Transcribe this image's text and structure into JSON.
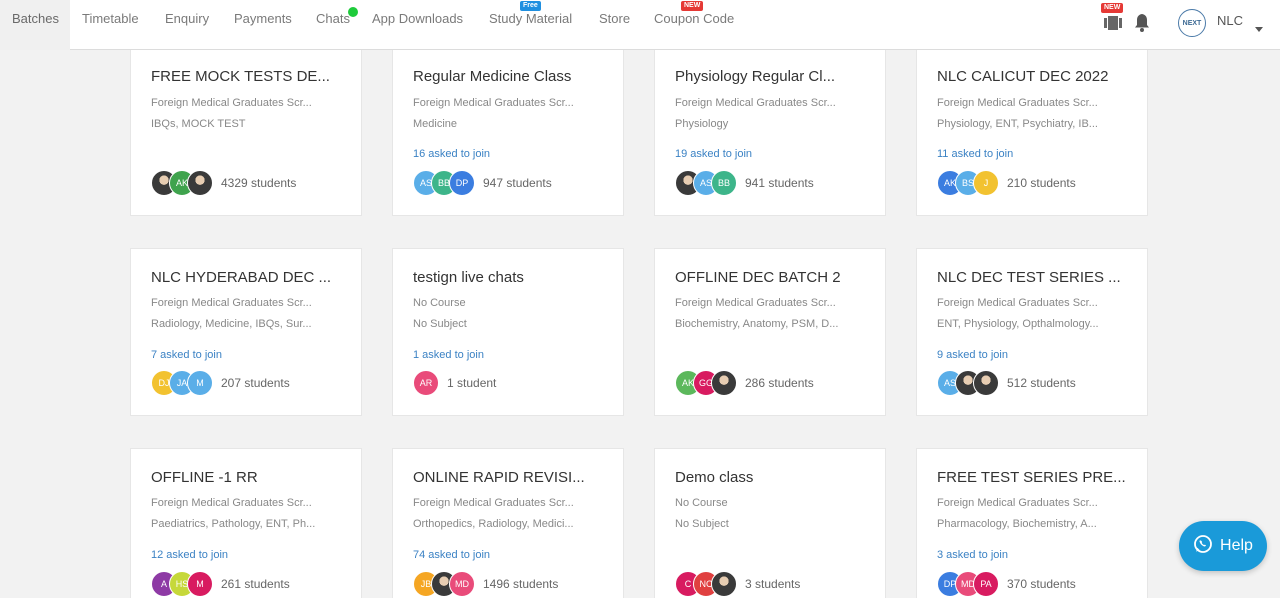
{
  "nav": {
    "items": [
      "Batches",
      "Timetable",
      "Enquiry",
      "Payments",
      "Chats",
      "App Downloads",
      "Study Material",
      "Store",
      "Coupon Code"
    ],
    "active": "Batches",
    "badges": {
      "free": "Free",
      "new": "NEW",
      "video_new": "NEW"
    },
    "online_color": "#1ecb3b"
  },
  "header_right": {
    "org_logo_text": "NEXT",
    "org_name": "NLC",
    "icons": [
      "video-library-icon",
      "bell-icon",
      "caret-down-icon"
    ]
  },
  "cards": [
    {
      "title": "FREE MOCK TESTS DE...",
      "line1": "Foreign Medical Graduates Scr...",
      "line2": "IBQs, MOCK TEST",
      "asked": "",
      "avatars": [
        {
          "t": "",
          "c": "photo"
        },
        {
          "t": "AK",
          "c": "#3fa34d"
        },
        {
          "t": "",
          "c": "photo"
        }
      ],
      "students": "4329 students"
    },
    {
      "title": "Regular Medicine Class",
      "line1": "Foreign Medical Graduates Scr...",
      "line2": "Medicine",
      "asked": "16 asked to join",
      "avatars": [
        {
          "t": "AS",
          "c": "#5aaee8"
        },
        {
          "t": "BB",
          "c": "#3db58a"
        },
        {
          "t": "DP",
          "c": "#3b7de0"
        }
      ],
      "students": "947 students"
    },
    {
      "title": "Physiology Regular Cl...",
      "line1": "Foreign Medical Graduates Scr...",
      "line2": "Physiology",
      "asked": "19 asked to join",
      "avatars": [
        {
          "t": "",
          "c": "photo"
        },
        {
          "t": "AS",
          "c": "#5aaee8"
        },
        {
          "t": "BB",
          "c": "#3db58a"
        }
      ],
      "students": "941 students"
    },
    {
      "title": "NLC CALICUT DEC 2022",
      "line1": "Foreign Medical Graduates Scr...",
      "line2": "Physiology, ENT, Psychiatry, IB...",
      "asked": "11 asked to join",
      "avatars": [
        {
          "t": "AK",
          "c": "#3b7de0"
        },
        {
          "t": "BS",
          "c": "#5aaee8"
        },
        {
          "t": "J",
          "c": "#f2c230"
        }
      ],
      "students": "210 students"
    },
    {
      "title": "NLC HYDERABAD DEC ...",
      "line1": "Foreign Medical Graduates Scr...",
      "line2": "Radiology, Medicine, IBQs, Sur...",
      "asked": "7 asked to join",
      "avatars": [
        {
          "t": "DJ",
          "c": "#f2c230"
        },
        {
          "t": "JA",
          "c": "#5aaee8"
        },
        {
          "t": "M",
          "c": "#5aaee8"
        }
      ],
      "students": "207 students"
    },
    {
      "title": "testign live chats",
      "line1": "No Course",
      "line2": "No Subject",
      "asked": "1 asked to join",
      "avatars": [
        {
          "t": "AR",
          "c": "#e94b7a"
        }
      ],
      "students": "1 student"
    },
    {
      "title": "OFFLINE DEC BATCH 2",
      "line1": "Foreign Medical Graduates Scr...",
      "line2": "Biochemistry, Anatomy, PSM, D...",
      "asked": "",
      "avatars": [
        {
          "t": "AK",
          "c": "#5cb85c"
        },
        {
          "t": "GG",
          "c": "#d81b60"
        },
        {
          "t": "",
          "c": "photo"
        }
      ],
      "students": "286 students"
    },
    {
      "title": "NLC DEC TEST SERIES ...",
      "line1": "Foreign Medical Graduates Scr...",
      "line2": "ENT, Physiology, Opthalmology...",
      "asked": "9 asked to join",
      "avatars": [
        {
          "t": "AS",
          "c": "#5aaee8"
        },
        {
          "t": "",
          "c": "photo"
        },
        {
          "t": "",
          "c": "photo"
        }
      ],
      "students": "512 students"
    },
    {
      "title": "OFFLINE -1 RR",
      "line1": "Foreign Medical Graduates Scr...",
      "line2": "Paediatrics, Pathology, ENT, Ph...",
      "asked": "12 asked to join",
      "avatars": [
        {
          "t": "A",
          "c": "#8e3aa5"
        },
        {
          "t": "HS",
          "c": "#c6d83a"
        },
        {
          "t": "M",
          "c": "#d81b60"
        }
      ],
      "students": "261 students"
    },
    {
      "title": "ONLINE RAPID REVISI...",
      "line1": "Foreign Medical Graduates Scr...",
      "line2": "Orthopedics, Radiology, Medici...",
      "asked": "74 asked to join",
      "avatars": [
        {
          "t": "JB",
          "c": "#f5a623"
        },
        {
          "t": "",
          "c": "photo"
        },
        {
          "t": "MD",
          "c": "#e94b7a"
        }
      ],
      "students": "1496 students"
    },
    {
      "title": "Demo class",
      "line1": "No Course",
      "line2": "No Subject",
      "asked": "",
      "avatars": [
        {
          "t": "C",
          "c": "#d81b60"
        },
        {
          "t": "NC",
          "c": "#e04040"
        },
        {
          "t": "",
          "c": "photo"
        }
      ],
      "students": "3 students"
    },
    {
      "title": "FREE TEST SERIES PRE...",
      "line1": "Foreign Medical Graduates Scr...",
      "line2": "Pharmacology, Biochemistry, A...",
      "asked": "3 asked to join",
      "avatars": [
        {
          "t": "DP",
          "c": "#3b7de0"
        },
        {
          "t": "MD",
          "c": "#e94b7a"
        },
        {
          "t": "PA",
          "c": "#d81b60"
        }
      ],
      "students": "370 students"
    }
  ],
  "help": {
    "label": "Help",
    "icon": "whatsapp-icon",
    "color": "#1a9ad9"
  }
}
